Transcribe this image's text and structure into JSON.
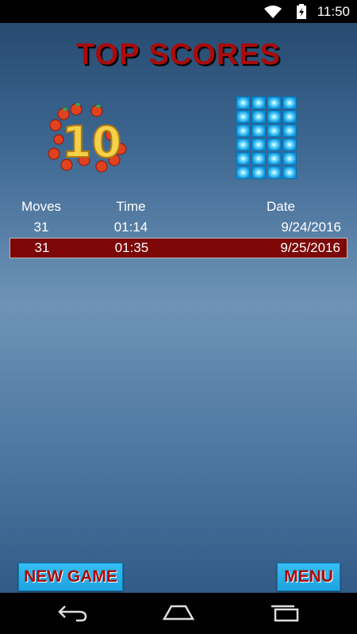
{
  "status_bar": {
    "time": "11:50",
    "icons": [
      "wifi-icon",
      "battery-charging-icon"
    ]
  },
  "title": "TOP SCORES",
  "icons": {
    "left": "apples-ten-icon",
    "right": "tile-grid-icon"
  },
  "table": {
    "headers": [
      "Moves",
      "Time",
      "Date"
    ],
    "rows": [
      {
        "moves": "31",
        "time": "01:14",
        "date": "9/24/2016",
        "selected": false
      },
      {
        "moves": "31",
        "time": "01:35",
        "date": "9/25/2016",
        "selected": true
      }
    ]
  },
  "buttons": {
    "new_game": "NEW GAME",
    "menu": "MENU"
  },
  "nav": {
    "icons": [
      "back-icon",
      "home-icon",
      "recents-icon"
    ]
  },
  "colors": {
    "title": "#a80c0c",
    "selected_row": "#7d0606",
    "button_bg": "#29b6ee"
  }
}
